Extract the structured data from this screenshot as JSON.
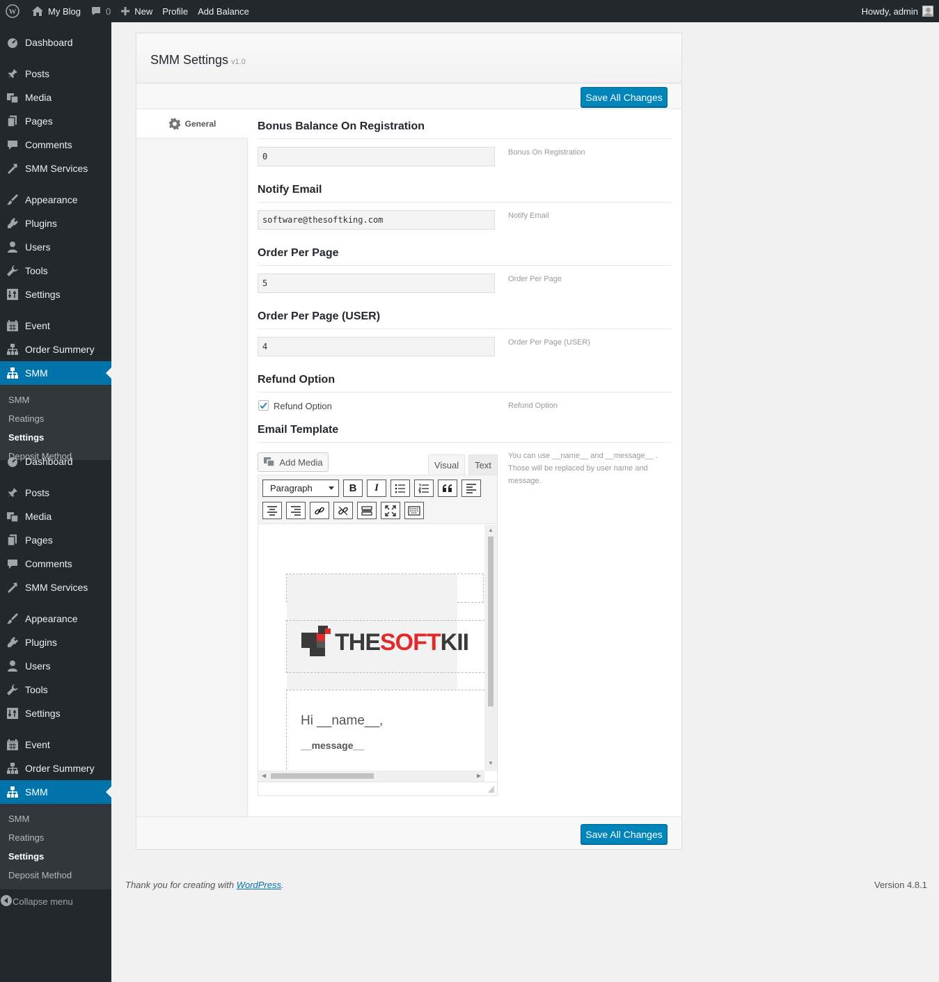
{
  "adminbar": {
    "site_name": "My Blog",
    "comments_count": "0",
    "new_label": "New",
    "profile_label": "Profile",
    "add_balance_label": "Add Balance",
    "howdy": "Howdy, admin"
  },
  "sidebar": {
    "menu_a": {
      "dashboard": "Dashboard",
      "posts": "Posts",
      "media": "Media",
      "pages": "Pages",
      "comments": "Comments",
      "smm_services": "SMM Services",
      "appearance": "Appearance",
      "plugins": "Plugins",
      "users": "Users",
      "tools": "Tools",
      "settings": "Settings",
      "event": "Event",
      "order_summery": "Order Summery",
      "smm": "SMM",
      "sub_smm": "SMM",
      "sub_reatings": "Reatings",
      "sub_settings": "Settings",
      "sub_deposit": "Deposit Method"
    },
    "menu_b": {
      "dashboard": "Dashboard",
      "posts": "Posts",
      "media": "Media",
      "pages": "Pages",
      "comments": "Comments",
      "smm_services": "SMM Services",
      "appearance": "Appearance",
      "plugins": "Plugins",
      "users": "Users",
      "tools": "Tools",
      "settings": "Settings",
      "event": "Event",
      "order_summery": "Order Summery",
      "smm": "SMM",
      "sub_smm": "SMM",
      "sub_reatings": "Reatings",
      "sub_settings": "Settings",
      "sub_deposit": "Deposit Method"
    },
    "collapse_label": "Collapse menu"
  },
  "panel": {
    "title": "SMM Settings",
    "version": "v1.0",
    "save_top": "Save All Changes",
    "save_bottom": "Save All Changes",
    "tab_general": "General"
  },
  "fields": {
    "bonus": {
      "title": "Bonus Balance On Registration",
      "value": "0",
      "help": "Bonus On Registration"
    },
    "notify": {
      "title": "Notify Email",
      "value": "software@thesoftking.com",
      "help": "Notify Email"
    },
    "order_page": {
      "title": "Order Per Page",
      "value": "5",
      "help": "Order Per Page"
    },
    "order_page_user": {
      "title": "Order Per Page (USER)",
      "value": "4",
      "help": "Order Per Page (USER)"
    },
    "refund": {
      "title": "Refund Option",
      "checkbox_label": "Refund Option",
      "checked": true,
      "help": "Refund Option"
    },
    "email_template": {
      "title": "Email Template",
      "help_line1": "You can use __name__ and __message__ .",
      "help_line2": "Those will be replaced by user name and",
      "help_line3": "message."
    }
  },
  "editor": {
    "add_media": "Add Media",
    "tab_visual": "Visual",
    "tab_text": "Text",
    "format_select": "Paragraph",
    "logo_text_dark1": "THE",
    "logo_text_red": "SOFT",
    "logo_text_dark2": "KII",
    "greeting": "Hi __name__,",
    "message": "__message__"
  },
  "footer": {
    "thanks_prefix": "Thank you for creating with ",
    "thanks_link": "WordPress",
    "thanks_suffix": ".",
    "version": "Version 4.8.1"
  },
  "colors": {
    "admin_dark": "#23282d",
    "accent": "#0073aa",
    "button": "#0085ba",
    "logo_red": "#e02b2b",
    "logo_dark": "#3a3a3a"
  }
}
